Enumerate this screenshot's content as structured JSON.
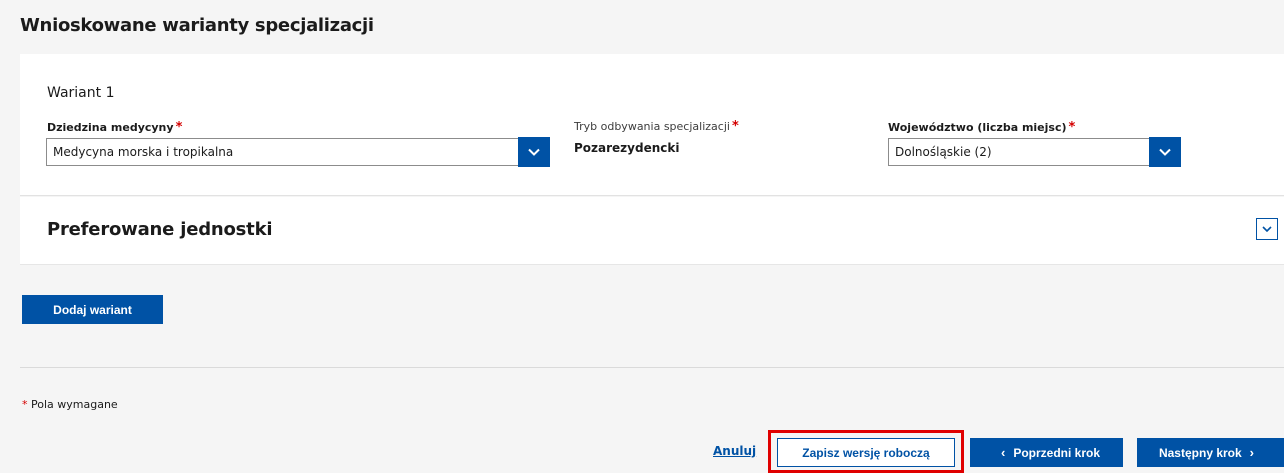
{
  "section": {
    "title": "Wnioskowane warianty specjalizacji"
  },
  "variant": {
    "title": "Wariant 1",
    "field_domain": {
      "label": "Dziedzina medycyny",
      "value": "Medycyna morska i tropikalna"
    },
    "field_mode": {
      "label": "Tryb odbywania specjalizacji",
      "value": "Pozarezydencki"
    },
    "field_region": {
      "label": "Województwo (liczba miejsc)",
      "value": "Dolnośląskie (2)"
    },
    "required_mark": "*"
  },
  "preferred": {
    "title": "Preferowane jednostki"
  },
  "actions": {
    "add_variant": "Dodaj wariant",
    "required_note": "Pola wymagane",
    "cancel": "Anuluj",
    "save_draft": "Zapisz wersję roboczą",
    "prev_step": "Poprzedni krok",
    "next_step": "Następny krok"
  },
  "colors": {
    "primary": "#0052a5",
    "required": "#d40000",
    "highlight": "#e00000"
  },
  "icons": {
    "dropdown": "chevron-down-icon",
    "prev": "chevron-left-icon",
    "next": "chevron-right-icon"
  }
}
